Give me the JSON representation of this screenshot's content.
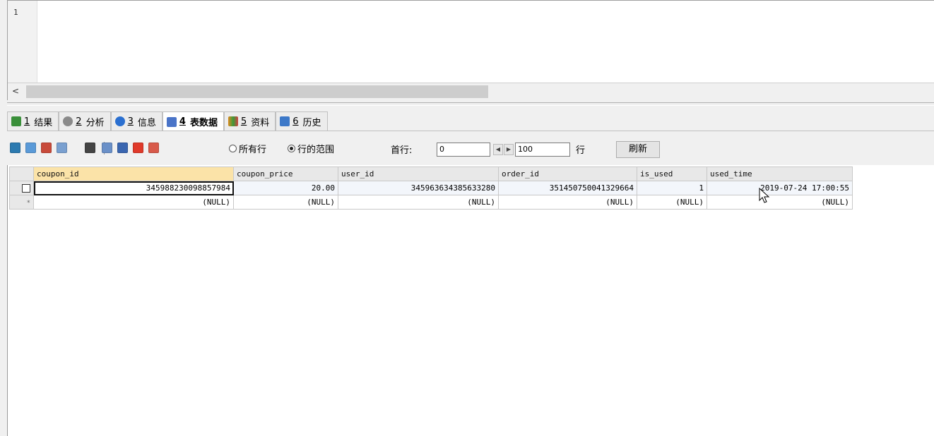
{
  "editor": {
    "line_number": "1",
    "scroll_left": "<"
  },
  "tabs": [
    {
      "num": "1",
      "label": "结果",
      "icon": "result-icon",
      "color": "#3a8f3a"
    },
    {
      "num": "2",
      "label": "分析",
      "icon": "profiler-icon",
      "color": "#8a8a8a"
    },
    {
      "num": "3",
      "label": "信息",
      "icon": "info-icon",
      "color": "#2a6fd0"
    },
    {
      "num": "4",
      "label": "表数据",
      "icon": "table-data-icon",
      "color": "#4a74c8"
    },
    {
      "num": "5",
      "label": "资料",
      "icon": "info-chart-icon",
      "color": "#e08a20"
    },
    {
      "num": "6",
      "label": "历史",
      "icon": "history-icon",
      "color": "#3c78c8"
    }
  ],
  "toolbar": {
    "radio_all": "所有行",
    "radio_range": "行的范围",
    "first_row_label": "首行:",
    "first_row_value": "0",
    "row_count_value": "100",
    "rows_label": "行",
    "refresh_label": "刷新",
    "prev_arrow": "◀",
    "next_arrow": "▶"
  },
  "grid": {
    "columns": [
      "coupon_id",
      "coupon_price",
      "user_id",
      "order_id",
      "is_used",
      "used_time"
    ],
    "rows": [
      [
        "345988230098857984",
        "20.00",
        "345963634385633280",
        "351450750041329664",
        "1",
        "2019-07-24 17:00:55"
      ],
      [
        "(NULL)",
        "(NULL)",
        "(NULL)",
        "(NULL)",
        "(NULL)",
        "(NULL)"
      ]
    ],
    "new_row_marker": "*"
  }
}
